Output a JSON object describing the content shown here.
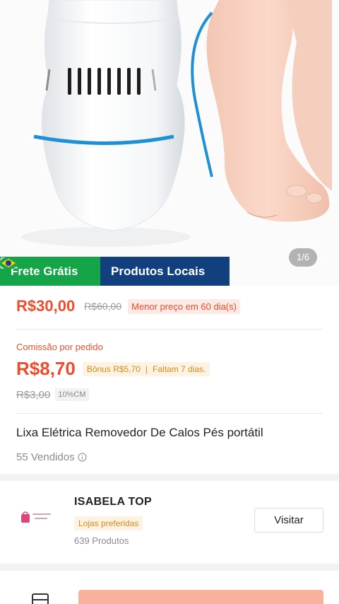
{
  "gallery": {
    "counter": "1/6",
    "badges": [
      {
        "label": "Frete Grátis",
        "icon": "truck-icon",
        "color": "#15a447"
      },
      {
        "label": "Produtos Locais",
        "icon": "brazil-flag-icon",
        "color": "#12407f"
      }
    ]
  },
  "price": {
    "current": "R$30,00",
    "original": "R$60,00",
    "lowest_tag": "Menor preço em 60 dia(s)"
  },
  "commission": {
    "label": "Comissão por pedido",
    "value": "R$8,70",
    "bonus": "Bônus R$5,70",
    "days_left": "Faltam 7 dias.",
    "old_value": "R$3,00",
    "rate": "10%CM"
  },
  "product": {
    "title": "Lixa Elétrica Removedor De Calos Pés portátil",
    "sold": "55 Vendidos"
  },
  "shop": {
    "name": "ISABELA TOP",
    "tag": "Lojas preferidas",
    "products": "639 Produtos",
    "visit_label": "Visitar"
  },
  "colors": {
    "accent": "#ee4d2d",
    "bonus": "#d98b1d",
    "badge_green": "#15a447",
    "badge_blue": "#12407f"
  }
}
